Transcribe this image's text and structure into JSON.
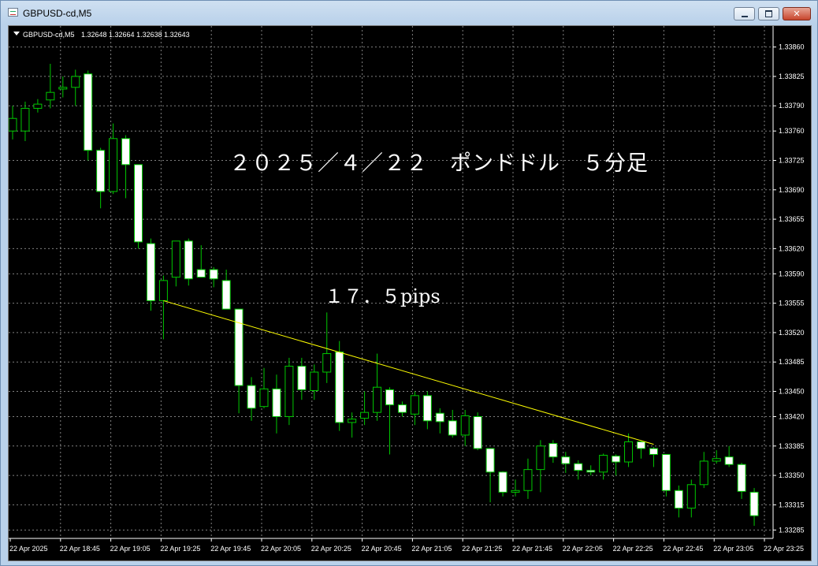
{
  "window": {
    "title": "GBPUSD-cd,M5",
    "close_glyph": "✕"
  },
  "info_line": {
    "symbol": "GBPUSD-cd,M5",
    "ohlc": "1.32648 1.32664 1.32638 1.32643",
    "dropdown_icon": "triangle-down-icon"
  },
  "annotations": {
    "title": "２０２５／４／２２　ポンドドル　５分足",
    "pips": "１７．５pips"
  },
  "colors": {
    "background": "#000000",
    "grid": "#808080",
    "bull_body": "#000000",
    "bear_body": "#ffffff",
    "wick": "#00c800",
    "trendline": "#ffff00",
    "text": "#ffffff"
  },
  "chart_data": {
    "type": "candlestick",
    "title": "GBPUSD-cd,M5",
    "yticks": [
      "1.33860",
      "1.33825",
      "1.33790",
      "1.33760",
      "1.33725",
      "1.33690",
      "1.33655",
      "1.33620",
      "1.33590",
      "1.33555",
      "1.33520",
      "1.33485",
      "1.33450",
      "1.33420",
      "1.33385",
      "1.33350",
      "1.33315",
      "1.33285"
    ],
    "xticks": [
      "22 Apr 2025",
      "22 Apr 18:45",
      "22 Apr 19:05",
      "22 Apr 19:25",
      "22 Apr 19:45",
      "22 Apr 20:05",
      "22 Apr 20:25",
      "22 Apr 20:45",
      "22 Apr 21:05",
      "22 Apr 21:25",
      "22 Apr 21:45",
      "22 Apr 22:05",
      "22 Apr 22:25",
      "22 Apr 22:45",
      "22 Apr 23:05",
      "22 Apr 23:25"
    ],
    "ylim": [
      1.33275,
      1.33885
    ],
    "grid": true,
    "candles": [
      {
        "o": 1.3376,
        "h": 1.3379,
        "l": 1.3375,
        "c": 1.33775
      },
      {
        "o": 1.3376,
        "h": 1.33795,
        "l": 1.33748,
        "c": 1.33787
      },
      {
        "o": 1.33787,
        "h": 1.33798,
        "l": 1.33782,
        "c": 1.33792
      },
      {
        "o": 1.33797,
        "h": 1.3384,
        "l": 1.33787,
        "c": 1.33806
      },
      {
        "o": 1.3381,
        "h": 1.33825,
        "l": 1.338,
        "c": 1.33812
      },
      {
        "o": 1.33812,
        "h": 1.33833,
        "l": 1.3379,
        "c": 1.33825
      },
      {
        "o": 1.33828,
        "h": 1.33832,
        "l": 1.33725,
        "c": 1.33737
      },
      {
        "o": 1.33737,
        "h": 1.3374,
        "l": 1.33668,
        "c": 1.33688
      },
      {
        "o": 1.33688,
        "h": 1.33769,
        "l": 1.33685,
        "c": 1.33751
      },
      {
        "o": 1.33751,
        "h": 1.33755,
        "l": 1.3368,
        "c": 1.3372
      },
      {
        "o": 1.3372,
        "h": 1.3372,
        "l": 1.3362,
        "c": 1.33628
      },
      {
        "o": 1.33626,
        "h": 1.33632,
        "l": 1.33546,
        "c": 1.33558
      },
      {
        "o": 1.33558,
        "h": 1.33588,
        "l": 1.33512,
        "c": 1.33582
      },
      {
        "o": 1.33586,
        "h": 1.33628,
        "l": 1.33575,
        "c": 1.33629
      },
      {
        "o": 1.33629,
        "h": 1.33632,
        "l": 1.33576,
        "c": 1.33584
      },
      {
        "o": 1.33595,
        "h": 1.33624,
        "l": 1.3359,
        "c": 1.33586
      },
      {
        "o": 1.33595,
        "h": 1.33598,
        "l": 1.33574,
        "c": 1.33584
      },
      {
        "o": 1.33582,
        "h": 1.33595,
        "l": 1.33552,
        "c": 1.33548
      },
      {
        "o": 1.33548,
        "h": 1.33548,
        "l": 1.33424,
        "c": 1.33457
      },
      {
        "o": 1.33457,
        "h": 1.33467,
        "l": 1.33415,
        "c": 1.3343
      },
      {
        "o": 1.33432,
        "h": 1.33478,
        "l": 1.3343,
        "c": 1.33453
      },
      {
        "o": 1.33453,
        "h": 1.3347,
        "l": 1.334,
        "c": 1.3342
      },
      {
        "o": 1.3342,
        "h": 1.3349,
        "l": 1.3341,
        "c": 1.3348
      },
      {
        "o": 1.3348,
        "h": 1.3349,
        "l": 1.3344,
        "c": 1.33452
      },
      {
        "o": 1.33451,
        "h": 1.33482,
        "l": 1.3344,
        "c": 1.33473
      },
      {
        "o": 1.33473,
        "h": 1.33544,
        "l": 1.3346,
        "c": 1.33495
      },
      {
        "o": 1.33497,
        "h": 1.3351,
        "l": 1.33403,
        "c": 1.33413
      },
      {
        "o": 1.33413,
        "h": 1.33425,
        "l": 1.33395,
        "c": 1.33417
      },
      {
        "o": 1.33418,
        "h": 1.3345,
        "l": 1.3341,
        "c": 1.33425
      },
      {
        "o": 1.33425,
        "h": 1.33495,
        "l": 1.33415,
        "c": 1.33455
      },
      {
        "o": 1.33452,
        "h": 1.33455,
        "l": 1.33375,
        "c": 1.33434
      },
      {
        "o": 1.33434,
        "h": 1.33438,
        "l": 1.3342,
        "c": 1.33425
      },
      {
        "o": 1.33423,
        "h": 1.3345,
        "l": 1.3341,
        "c": 1.33445
      },
      {
        "o": 1.33445,
        "h": 1.3345,
        "l": 1.33405,
        "c": 1.33415
      },
      {
        "o": 1.33424,
        "h": 1.3343,
        "l": 1.334,
        "c": 1.33414
      },
      {
        "o": 1.33415,
        "h": 1.33428,
        "l": 1.33395,
        "c": 1.33398
      },
      {
        "o": 1.33398,
        "h": 1.33428,
        "l": 1.33385,
        "c": 1.33421
      },
      {
        "o": 1.3342,
        "h": 1.33425,
        "l": 1.3338,
        "c": 1.33382
      },
      {
        "o": 1.33382,
        "h": 1.33382,
        "l": 1.33318,
        "c": 1.33354
      },
      {
        "o": 1.33354,
        "h": 1.33355,
        "l": 1.33325,
        "c": 1.3333
      },
      {
        "o": 1.3333,
        "h": 1.33345,
        "l": 1.33325,
        "c": 1.33332
      },
      {
        "o": 1.33332,
        "h": 1.3337,
        "l": 1.33322,
        "c": 1.33357
      },
      {
        "o": 1.33357,
        "h": 1.33392,
        "l": 1.3333,
        "c": 1.33385
      },
      {
        "o": 1.33388,
        "h": 1.33392,
        "l": 1.33365,
        "c": 1.33372
      },
      {
        "o": 1.33372,
        "h": 1.33378,
        "l": 1.33353,
        "c": 1.33364
      },
      {
        "o": 1.33364,
        "h": 1.33368,
        "l": 1.33345,
        "c": 1.33356
      },
      {
        "o": 1.33356,
        "h": 1.33362,
        "l": 1.3335,
        "c": 1.33354
      },
      {
        "o": 1.33354,
        "h": 1.33376,
        "l": 1.33345,
        "c": 1.33374
      },
      {
        "o": 1.33373,
        "h": 1.33375,
        "l": 1.3335,
        "c": 1.33366
      },
      {
        "o": 1.33366,
        "h": 1.334,
        "l": 1.3336,
        "c": 1.3339
      },
      {
        "o": 1.3339,
        "h": 1.33392,
        "l": 1.3337,
        "c": 1.33382
      },
      {
        "o": 1.33382,
        "h": 1.33384,
        "l": 1.3336,
        "c": 1.33375
      },
      {
        "o": 1.33375,
        "h": 1.33375,
        "l": 1.33325,
        "c": 1.33332
      },
      {
        "o": 1.33332,
        "h": 1.33338,
        "l": 1.333,
        "c": 1.33311
      },
      {
        "o": 1.33311,
        "h": 1.33345,
        "l": 1.333,
        "c": 1.33339
      },
      {
        "o": 1.33339,
        "h": 1.33378,
        "l": 1.33335,
        "c": 1.33367
      },
      {
        "o": 1.33367,
        "h": 1.3338,
        "l": 1.33364,
        "c": 1.3337
      },
      {
        "o": 1.33372,
        "h": 1.33385,
        "l": 1.3336,
        "c": 1.33363
      },
      {
        "o": 1.33363,
        "h": 1.33365,
        "l": 1.33322,
        "c": 1.33331
      },
      {
        "o": 1.3333,
        "h": 1.33335,
        "l": 1.3329,
        "c": 1.33302
      }
    ],
    "trendline": {
      "from_index": 12,
      "from_price": 1.33558,
      "to_index": 51,
      "to_price": 1.33387
    }
  }
}
